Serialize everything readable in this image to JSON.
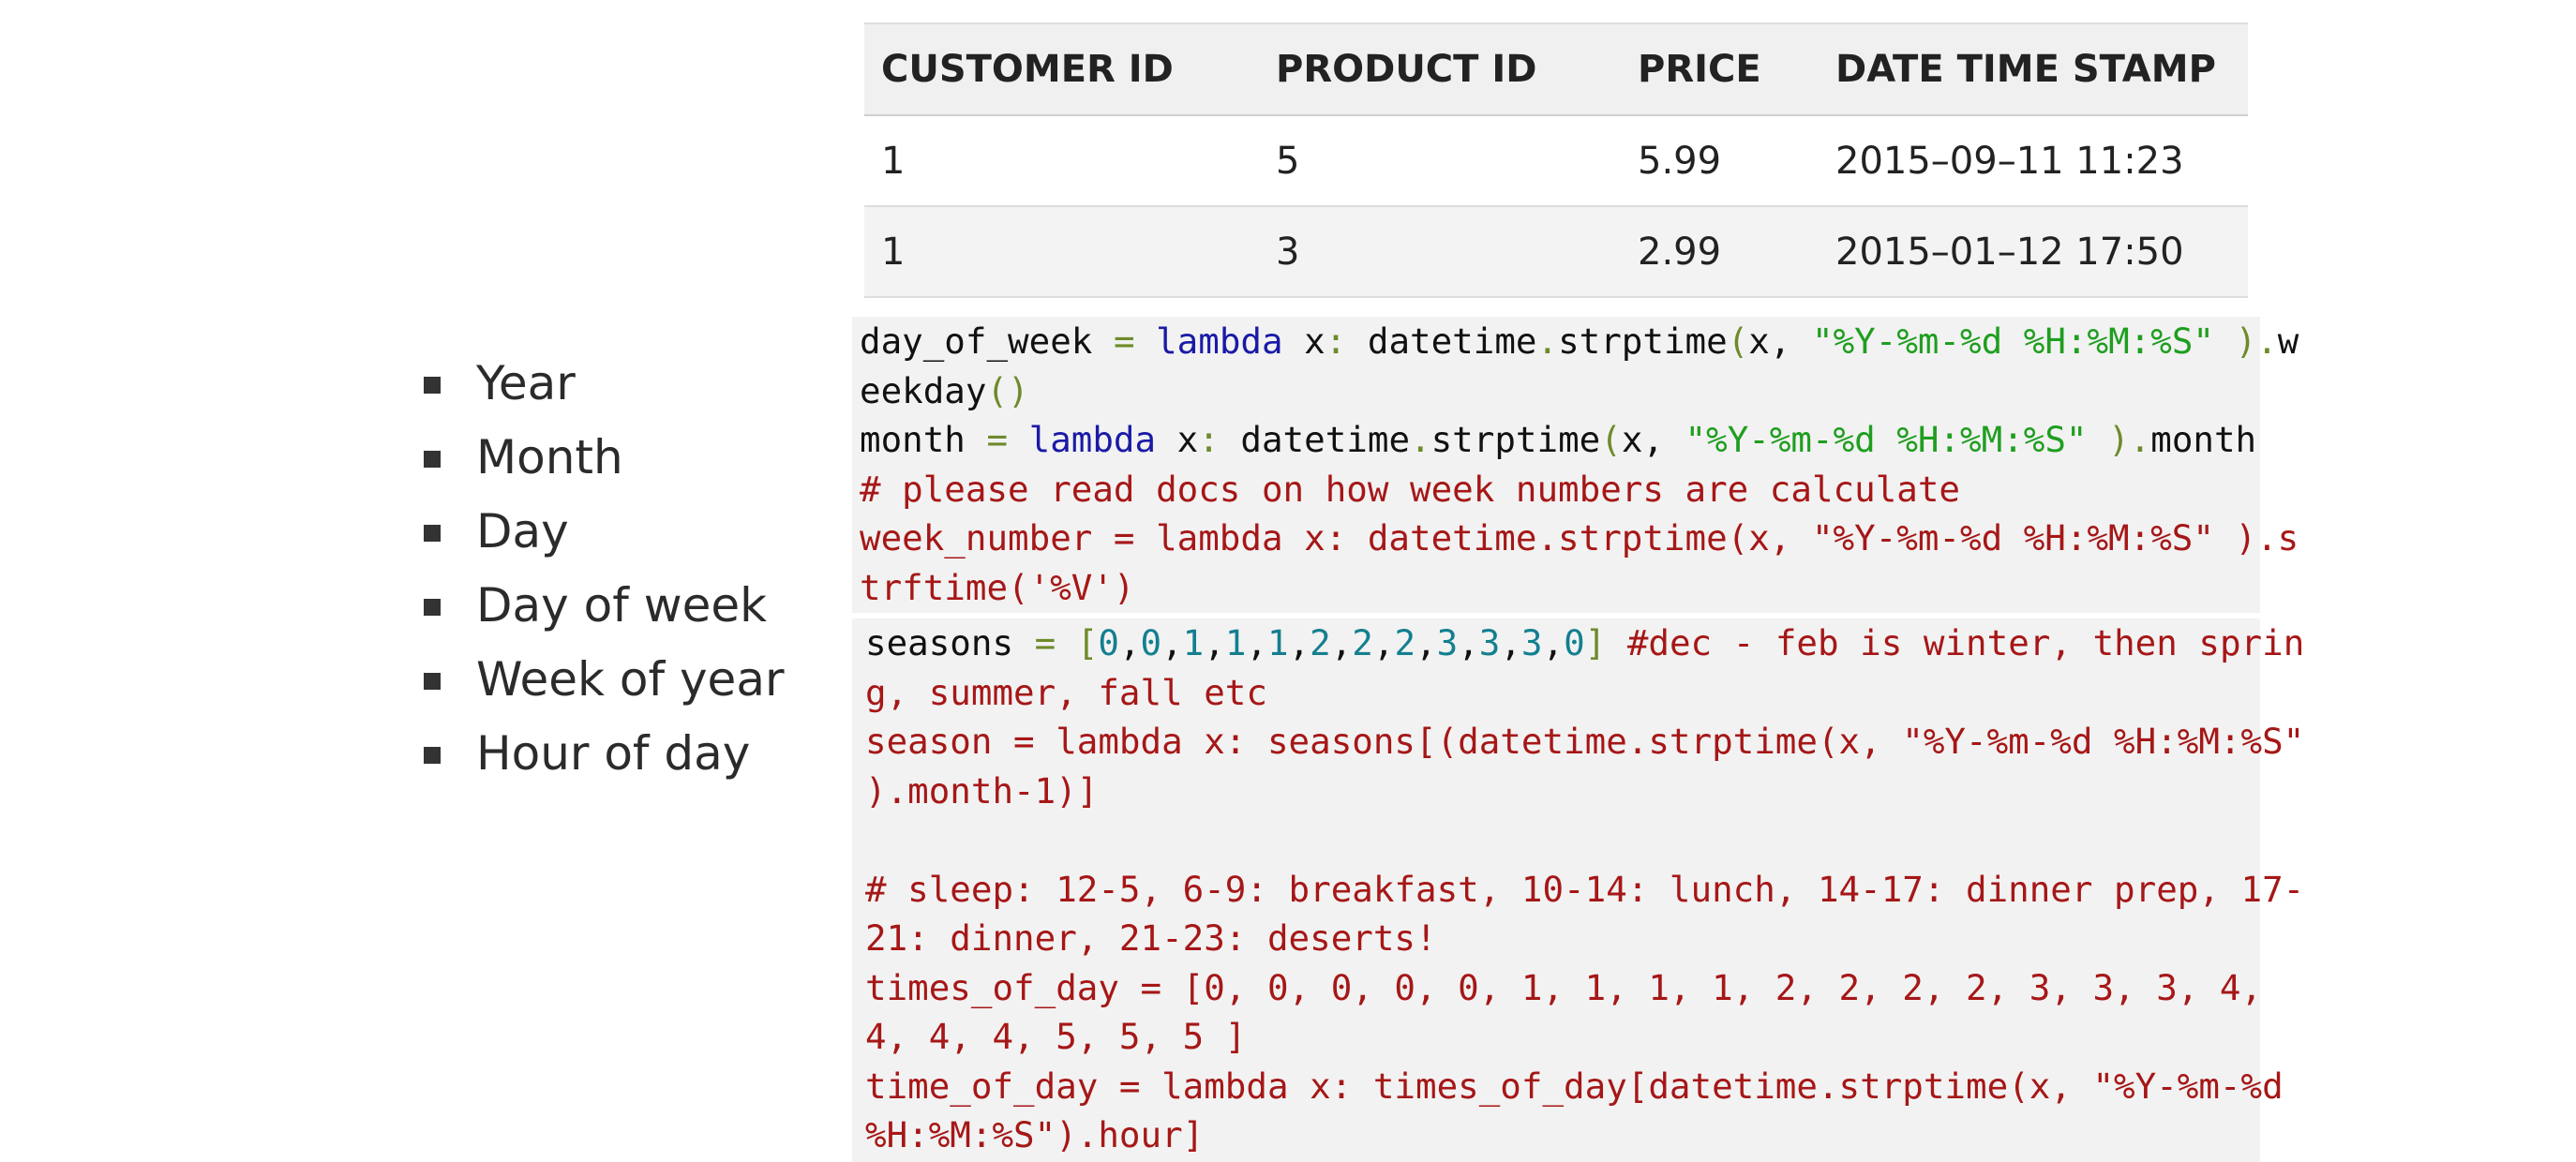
{
  "feature_list": {
    "items": [
      "Year",
      "Month",
      "Day",
      "Day of week",
      "Week of year",
      "Hour of day"
    ]
  },
  "table": {
    "headers": [
      "CUSTOMER ID",
      "PRODUCT ID",
      "PRICE",
      "DATE TIME STAMP"
    ],
    "rows": [
      [
        "1",
        "5",
        "5.99",
        "2015–09–11 11:23"
      ],
      [
        "1",
        "3",
        "2.99",
        "2015–01–12 17:50"
      ]
    ]
  },
  "code": {
    "block1_lines": [
      "day_of_week = lambda x: datetime.strptime(x, \"%Y-%m-%d %H:%M:%S\" ).w",
      "eekday()",
      "month = lambda x: datetime.strptime(x, \"%Y-%m-%d %H:%M:%S\" ).month",
      "# please read docs on how week numbers are calculate",
      "week_number = lambda x: datetime.strptime(x, \"%Y-%m-%d %H:%M:%S\" ).s",
      "trftime('%V')"
    ],
    "block2_lines": [
      "seasons = [0,0,1,1,1,2,2,2,3,3,3,0] #dec - feb is winter, then sprin",
      "g, summer, fall etc",
      "season = lambda x: seasons[(datetime.strptime(x, \"%Y-%m-%d %H:%M:%S\"",
      ").month-1)]",
      "",
      "# sleep: 12-5, 6-9: breakfast, 10-14: lunch, 14-17: dinner prep, 17-",
      "21: dinner, 21-23: deserts!",
      "times_of_day = [0, 0, 0, 0, 0, 1, 1, 1, 1, 2, 2, 2, 2, 3, 3, 3, 4,",
      "4, 4, 4, 5, 5, 5 ]",
      "time_of_day = lambda x: times_of_day[datetime.strptime(x, \"%Y-%m-%d",
      "%H:%M:%S\").hour]"
    ]
  },
  "colors": {
    "keyword": "#1a1aa6",
    "string": "#1f9e1f",
    "number": "#137f8f",
    "operator": "#6e8a2a",
    "comment": "#a61717",
    "code_background": "#f2f2f2",
    "table_header_background": "#f0f0f0"
  }
}
